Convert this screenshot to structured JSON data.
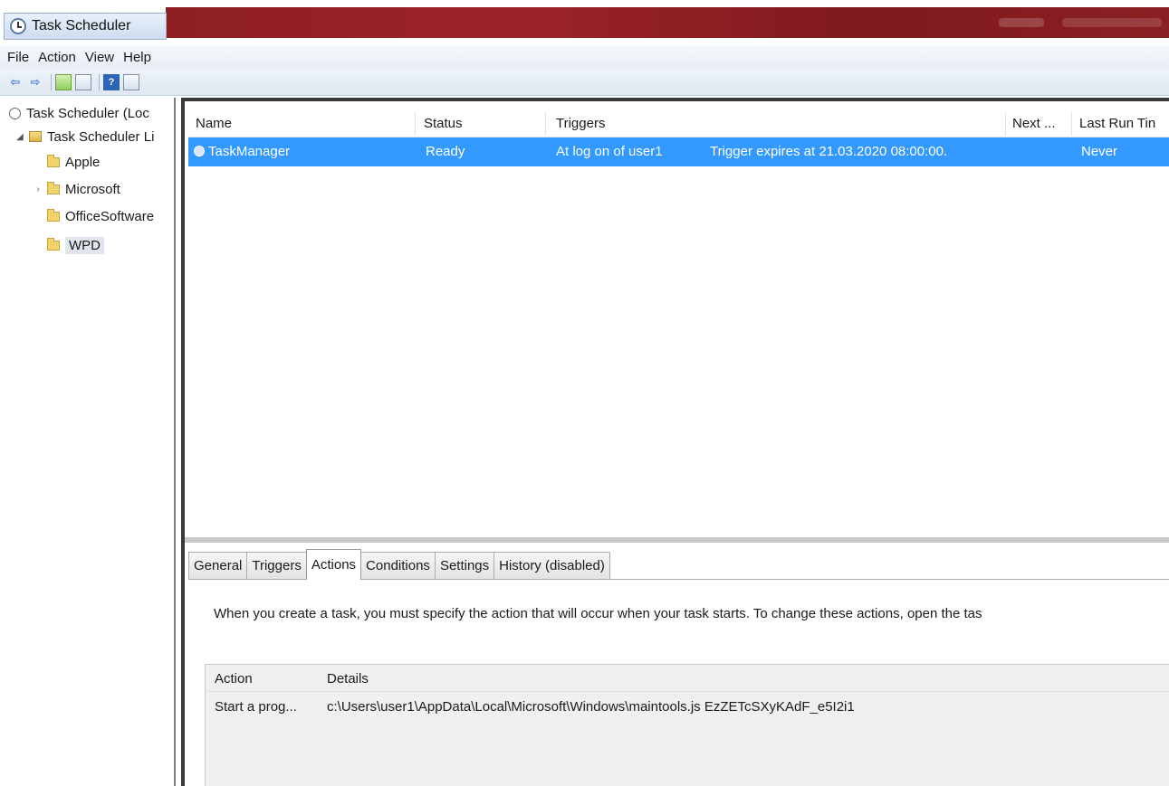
{
  "window": {
    "title": "Task Scheduler"
  },
  "menu": {
    "items": [
      "File",
      "Action",
      "View",
      "Help"
    ]
  },
  "toolbar": {
    "icons": [
      "back-arrow-icon",
      "forward-arrow-icon",
      "folder-up-icon",
      "show-hide-icon",
      "help-icon",
      "properties-icon"
    ]
  },
  "tree": {
    "root": "Task Scheduler (Loc",
    "library": "Task Scheduler Li",
    "folders": [
      "Apple",
      "Microsoft",
      "OfficeSoftware",
      "WPD"
    ],
    "selected": "WPD"
  },
  "task_list": {
    "columns": [
      "Name",
      "Status",
      "Triggers",
      "Next ...",
      "Last Run Tin"
    ],
    "rows": [
      {
        "name": "TaskManager",
        "status": "Ready",
        "trigger": "At log on of user1",
        "trigger_detail": "Trigger expires at 21.03.2020 08:00:00.",
        "next_run": "",
        "last_run": "Never"
      }
    ]
  },
  "tabs": {
    "items": [
      "General",
      "Triggers",
      "Actions",
      "Conditions",
      "Settings",
      "History (disabled)"
    ],
    "active": "Actions"
  },
  "actions_panel": {
    "description": "When you create a task, you must specify the action that will occur when your task starts.  To change these actions, open the tas",
    "columns": [
      "Action",
      "Details"
    ],
    "rows": [
      {
        "action": "Start a prog...",
        "details": "c:\\Users\\user1\\AppData\\Local\\Microsoft\\Windows\\maintools.js EzZETcSXyKAdF_e5I2i1"
      }
    ]
  },
  "colors": {
    "selection": "#3399ff",
    "titlebar_accent": "#8e1f23"
  }
}
